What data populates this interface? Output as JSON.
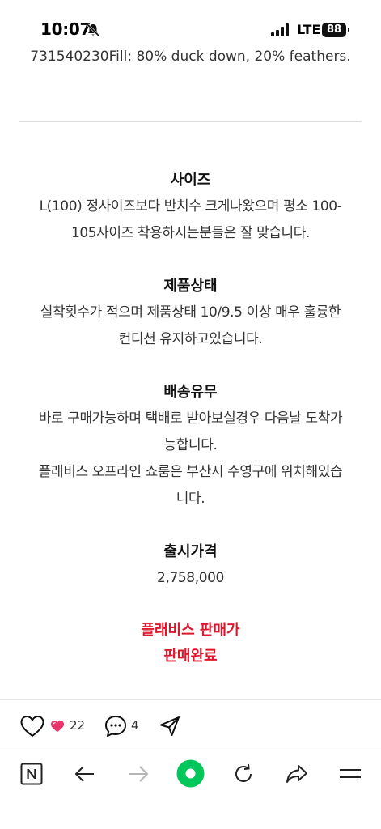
{
  "status_bar": {
    "time": "10:07",
    "network": "LTE",
    "battery": "88"
  },
  "article": {
    "cut_line": "731540230Fill: 80% duck down, 20% feathers.",
    "sections": [
      {
        "heading": "사이즈",
        "lines": [
          "L(100) 정사이즈보다 반치수 크게나왔으며 평소 100-",
          "105사이즈 착용하시는분들은 잘 맞습니다."
        ]
      },
      {
        "heading": "제품상태",
        "lines": [
          "실착횟수가 적으며 제품상태 10/9.5 이상 매우 훌륭한",
          "컨디션 유지하고있습니다."
        ]
      },
      {
        "heading": "배송유무",
        "lines": [
          "바로 구매가능하며 택배로 받아보실경우 다음날 도착가",
          "능합니다.",
          "플래비스 오프라인 쇼룸은 부산시 수영구에 위치해있습",
          "니다."
        ]
      },
      {
        "heading": "출시가격",
        "lines": [
          "2,758,000"
        ]
      }
    ],
    "sale_status": [
      "플래비스 판매가",
      "판매완료"
    ]
  },
  "reactions": {
    "like_count": "22",
    "comment_count": "4"
  },
  "icons": {
    "status": [
      "bell-muted-icon",
      "signal-icon",
      "battery-icon"
    ],
    "reactions": [
      "heart-icon",
      "small-heart-icon",
      "comment-icon",
      "send-icon"
    ],
    "toolbar": [
      "naver-n-icon",
      "back-arrow-icon",
      "forward-arrow-icon",
      "home-green-icon",
      "reload-icon",
      "share-arrow-icon",
      "menu-icon"
    ]
  },
  "colors": {
    "sale_red": "#e0162b",
    "like_pink": "#e8336b",
    "home_green": "#03c75a",
    "disabled_gray": "#b5b5b5"
  }
}
